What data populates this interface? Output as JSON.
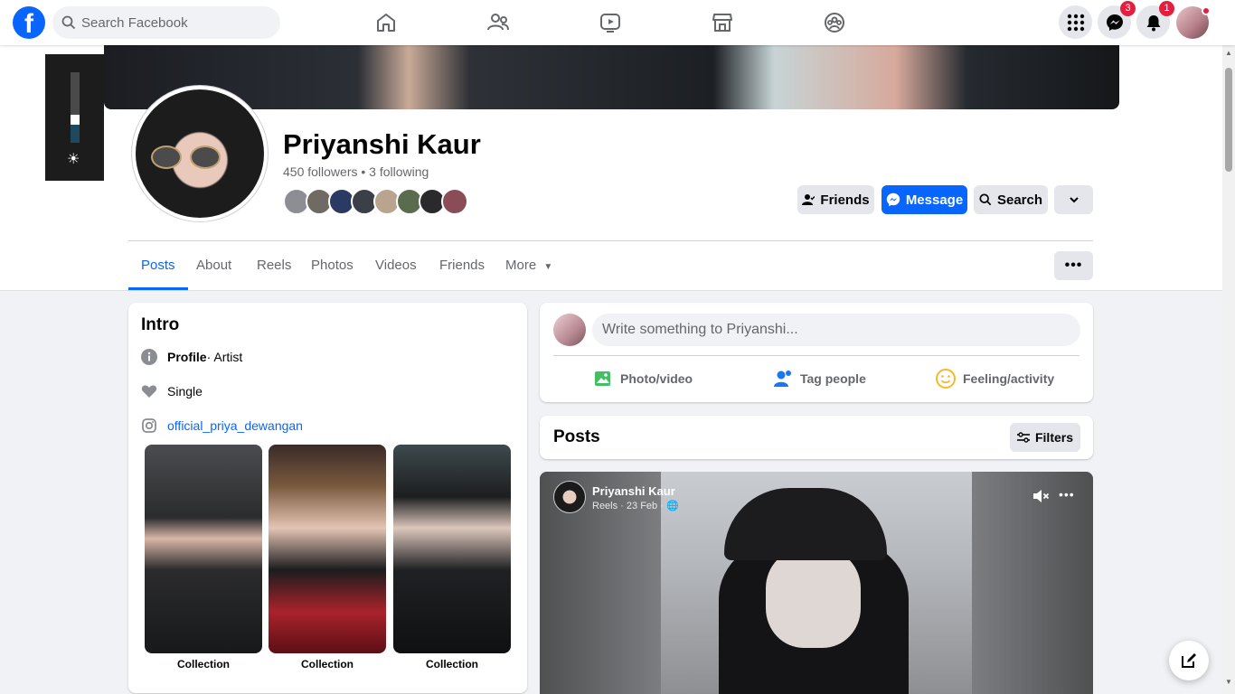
{
  "search": {
    "placeholder": "Search Facebook"
  },
  "nav": {
    "icons": [
      "home-icon",
      "friends-icon",
      "watch-icon",
      "marketplace-icon",
      "groups-icon"
    ]
  },
  "notifications": {
    "messenger_count": "3",
    "alerts_count": "1"
  },
  "profile": {
    "name": "Priyanshi Kaur",
    "followers": "450 followers • 3 following"
  },
  "actions": {
    "friends": "Friends",
    "message": "Message",
    "search": "Search"
  },
  "tabs": [
    "Posts",
    "About",
    "Reels",
    "Photos",
    "Videos",
    "Friends",
    "More"
  ],
  "intro": {
    "title": "Intro",
    "profile_label": "Profile",
    "profile_value": " · Artist",
    "relationship": "Single",
    "instagram": "official_priya_dewangan",
    "collections": [
      "Collection",
      "Collection",
      "Collection"
    ]
  },
  "composer": {
    "placeholder": "Write something to Priyanshi...",
    "photo_video": "Photo/video",
    "tag_people": "Tag people",
    "feeling": "Feeling/activity"
  },
  "posts": {
    "title": "Posts",
    "filters": "Filters"
  },
  "reel": {
    "author": "Priyanshi Kaur",
    "meta": "Reels · 23 Feb ·"
  },
  "colors": {
    "brand": "#0866ff",
    "badge": "#e41e3f"
  }
}
